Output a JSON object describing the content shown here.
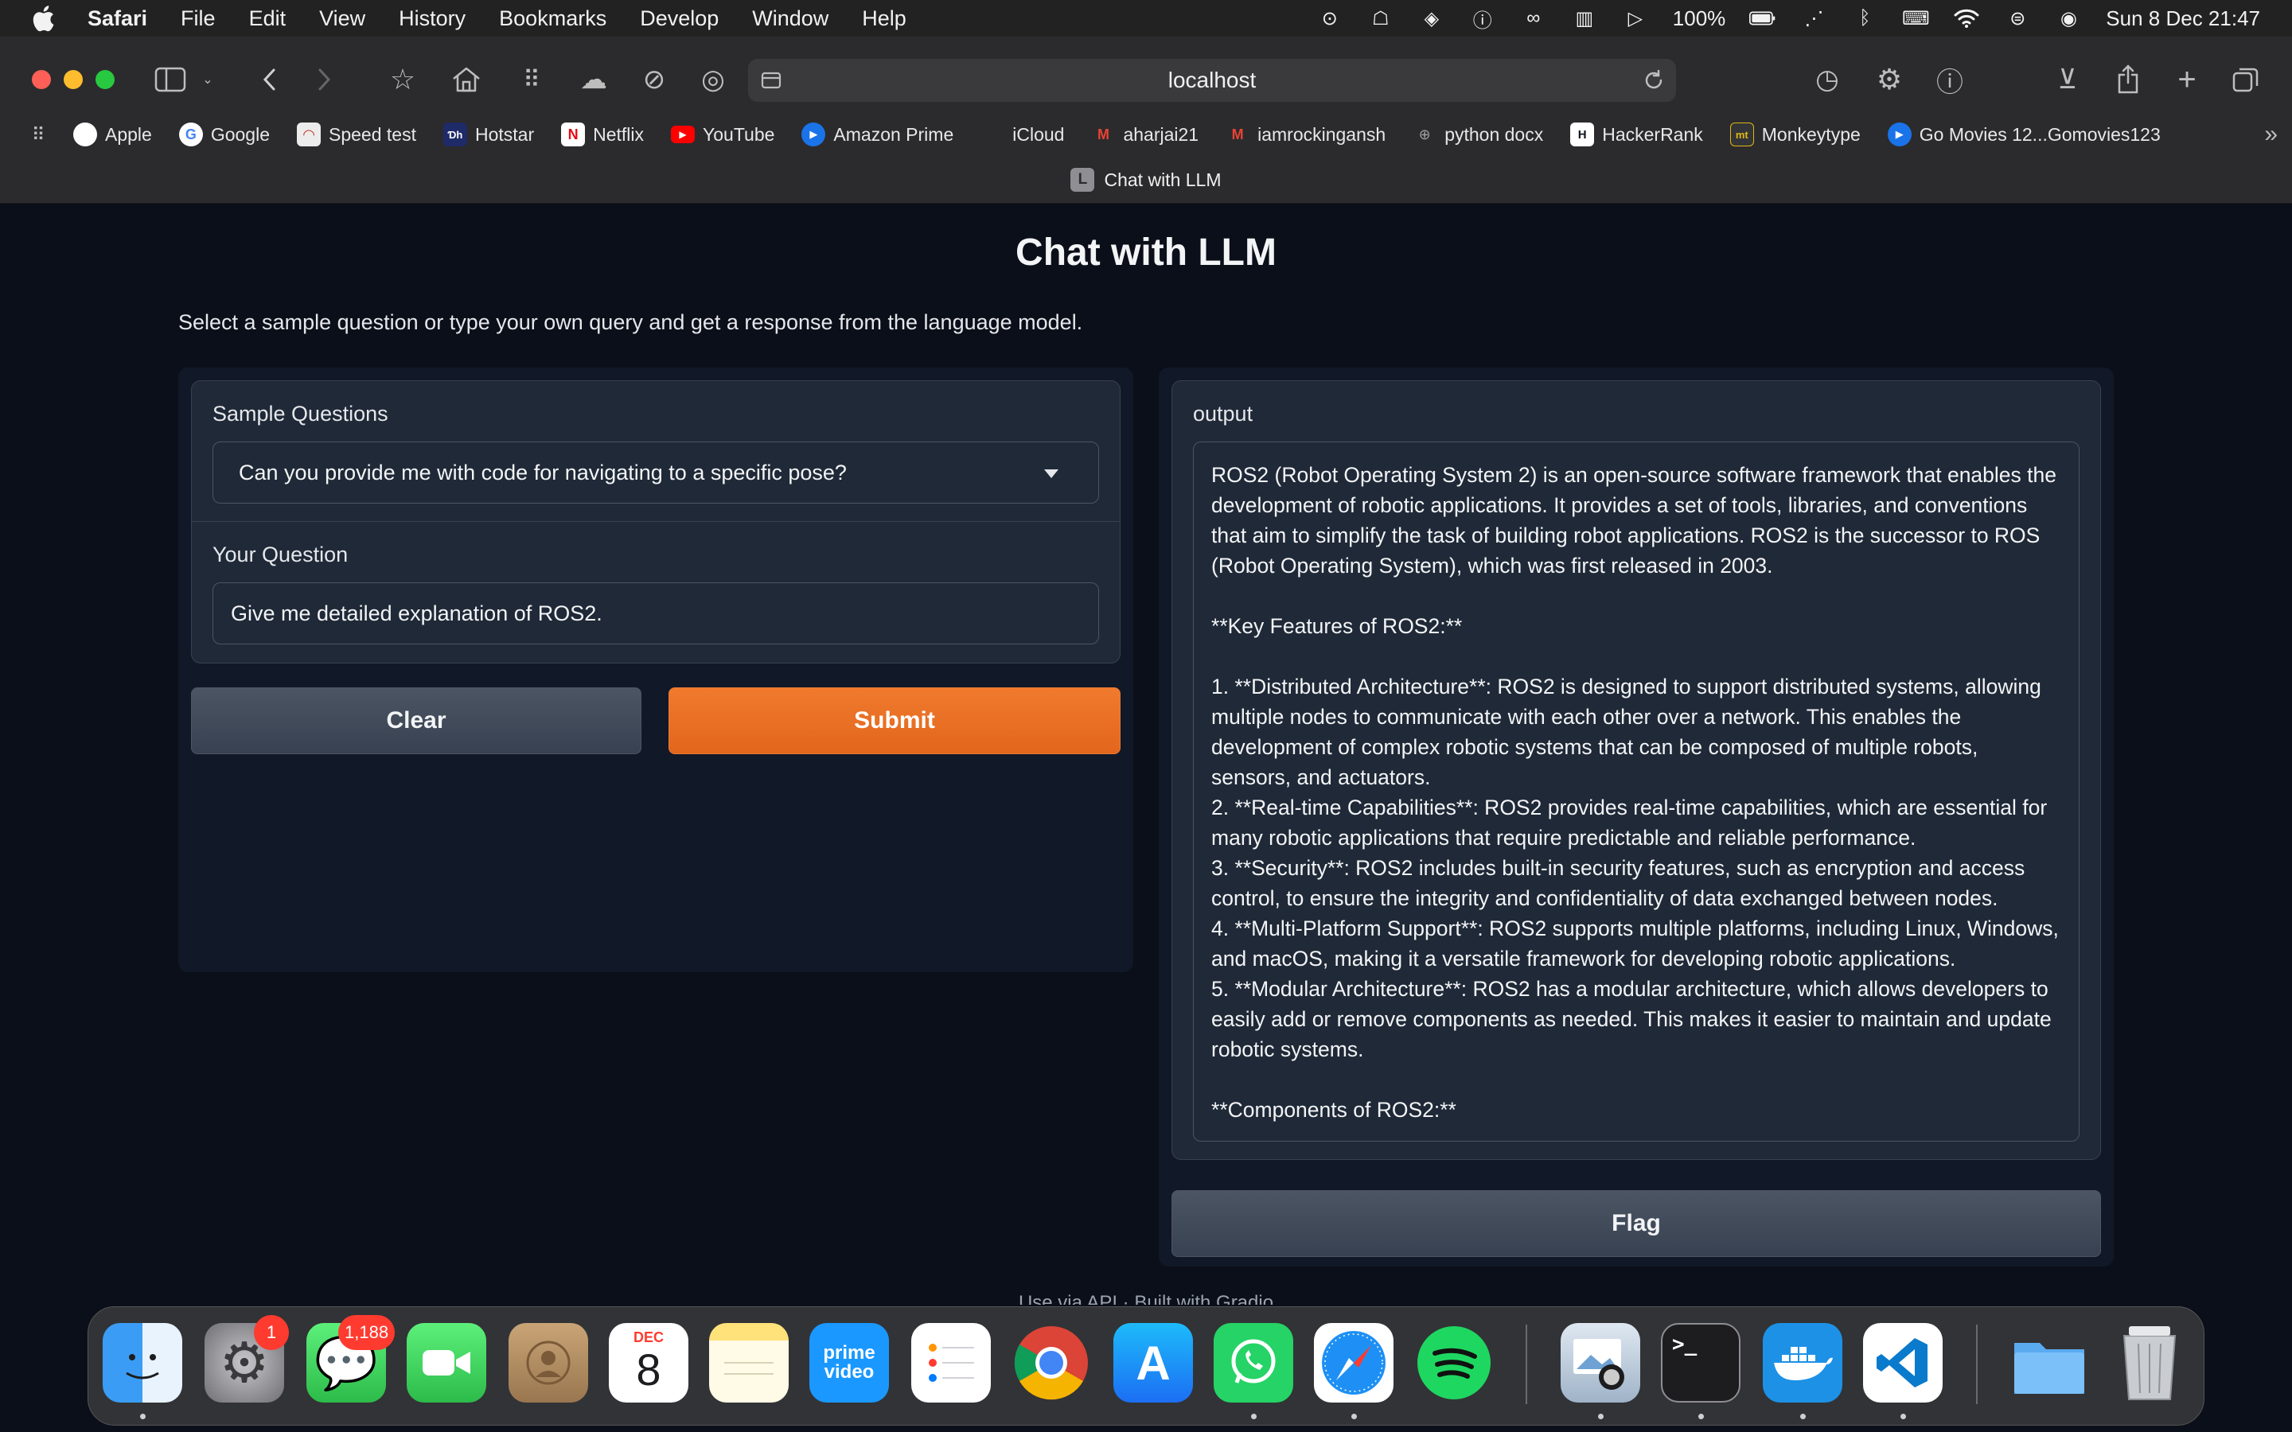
{
  "menubar": {
    "app_name": "Safari",
    "items": [
      "File",
      "Edit",
      "View",
      "History",
      "Bookmarks",
      "Develop",
      "Window",
      "Help"
    ],
    "battery": "100%",
    "datetime": "Sun 8 Dec  21:47"
  },
  "browser": {
    "address": "localhost",
    "tab_title": "Chat with LLM",
    "tab_favicon_letter": "L",
    "bookmarks": [
      {
        "label": "Apple",
        "icon": "apple-logo",
        "color": "#ffffff"
      },
      {
        "label": "Google",
        "icon": "google-logo",
        "color": "#4285f4"
      },
      {
        "label": "Speed test",
        "icon": "speedometer",
        "color": "#c0392b"
      },
      {
        "label": "Hotstar",
        "icon": "hotstar-logo",
        "color": "#1f2a68"
      },
      {
        "label": "Netflix",
        "icon": "netflix-logo",
        "color": "#e50914"
      },
      {
        "label": "YouTube",
        "icon": "youtube-logo",
        "color": "#ff0000"
      },
      {
        "label": "Amazon Prime",
        "icon": "play-circle",
        "color": "#1a73e8"
      },
      {
        "label": "iCloud",
        "icon": "apple-logo",
        "color": "#8e8e93"
      },
      {
        "label": "aharjai21",
        "icon": "gmail-logo",
        "color": "#ea4335"
      },
      {
        "label": "iamrockingansh",
        "icon": "gmail-logo",
        "color": "#ea4335"
      },
      {
        "label": "python docx",
        "icon": "globe",
        "color": "#8e8e93"
      },
      {
        "label": "HackerRank",
        "icon": "hackerrank-logo",
        "color": "#2ec866"
      },
      {
        "label": "Monkeytype",
        "icon": "monkeytype-logo",
        "color": "#e2b714"
      },
      {
        "label": "Go Movies 12...Gomovies123",
        "icon": "play-circle",
        "color": "#1a73e8"
      }
    ]
  },
  "app": {
    "title": "Chat with LLM",
    "description": "Select a sample question or type your own query and get a response from the language model.",
    "sample_label": "Sample Questions",
    "sample_selected": "Can you provide me with code for navigating to a specific pose?",
    "question_label": "Your Question",
    "question_value": "Give me detailed explanation of ROS2.",
    "clear_label": "Clear",
    "submit_label": "Submit",
    "output_label": "output",
    "output_text": "ROS2 (Robot Operating System 2) is an open-source software framework that enables the development of robotic applications. It provides a set of tools, libraries, and conventions that aim to simplify the task of building robot applications. ROS2 is the successor to ROS (Robot Operating System), which was first released in 2003.\n\n**Key Features of ROS2:**\n\n1. **Distributed Architecture**: ROS2 is designed to support distributed systems, allowing multiple nodes to communicate with each other over a network. This enables the development of complex robotic systems that can be composed of multiple robots, sensors, and actuators.\n2. **Real-time Capabilities**: ROS2 provides real-time capabilities, which are essential for many robotic applications that require predictable and reliable performance.\n3. **Security**: ROS2 includes built-in security features, such as encryption and access control, to ensure the integrity and confidentiality of data exchanged between nodes.\n4. **Multi-Platform Support**: ROS2 supports multiple platforms, including Linux, Windows, and macOS, making it a versatile framework for developing robotic applications.\n5. **Modular Architecture**: ROS2 has a modular architecture, which allows developers to easily add or remove components as needed. This makes it easier to maintain and update robotic systems.\n\n**Components of ROS2:**",
    "flag_label": "Flag",
    "footer": "Use via API  ·  Built with Gradio"
  },
  "dock": {
    "apps": [
      {
        "name": "Finder",
        "color": "#3b9cf5"
      },
      {
        "name": "System Settings",
        "color": "#8e8e93",
        "badge": "1"
      },
      {
        "name": "Messages",
        "color": "#34c759",
        "badge": "1,188"
      },
      {
        "name": "FaceTime",
        "color": "#34c759"
      },
      {
        "name": "Contacts",
        "color": "#a8865a"
      },
      {
        "name": "Calendar",
        "color": "#ffffff",
        "month": "DEC",
        "day": "8"
      },
      {
        "name": "Notes",
        "color": "#fff2a8"
      },
      {
        "name": "Prime Video",
        "color": "#1a98ff",
        "text": "prime video"
      },
      {
        "name": "Reminders",
        "color": "#ffffff"
      },
      {
        "name": "Chrome",
        "color": "#ffffff"
      },
      {
        "name": "App Store",
        "color": "#1c8ef9"
      },
      {
        "name": "WhatsApp",
        "color": "#25d366"
      },
      {
        "name": "Safari",
        "color": "#ffffff"
      },
      {
        "name": "Spotify",
        "color": "#1ed760"
      },
      {
        "name": "Preview",
        "color": "#cfd8e3"
      },
      {
        "name": "Terminal",
        "color": "#1d1d1f",
        "text": ">_"
      },
      {
        "name": "Docker",
        "color": "#1d91e6"
      },
      {
        "name": "VS Code",
        "color": "#ffffff"
      },
      {
        "name": "Downloads",
        "color": "#5aaaf0"
      },
      {
        "name": "Trash",
        "color": "#bfc3c7"
      }
    ]
  }
}
